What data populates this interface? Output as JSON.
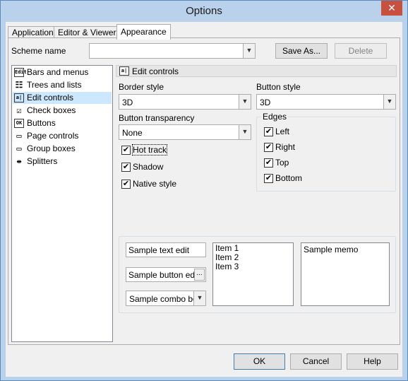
{
  "window": {
    "title": "Options",
    "close_glyph": "✕"
  },
  "tabs": [
    {
      "label": "Application"
    },
    {
      "label": "Editor & Viewers"
    },
    {
      "label": "Appearance",
      "active": true
    }
  ],
  "scheme": {
    "label": "Scheme name",
    "value": "",
    "save_as": "Save As...",
    "delete": "Delete"
  },
  "tree": {
    "items": [
      {
        "label": "Bars and menus",
        "icon": "bars-menus-icon",
        "glyph": "Edit"
      },
      {
        "label": "Trees and lists",
        "icon": "trees-lists-icon",
        "glyph": "☷"
      },
      {
        "label": "Edit controls",
        "icon": "edit-controls-icon",
        "glyph": "a|",
        "selected": true
      },
      {
        "label": "Check boxes",
        "icon": "check-boxes-icon",
        "glyph": "☑"
      },
      {
        "label": "Buttons",
        "icon": "buttons-icon",
        "glyph": "OK"
      },
      {
        "label": "Page controls",
        "icon": "page-controls-icon",
        "glyph": "▭"
      },
      {
        "label": "Group boxes",
        "icon": "group-boxes-icon",
        "glyph": "▭"
      },
      {
        "label": "Splitters",
        "icon": "splitters-icon",
        "glyph": "⇹"
      }
    ]
  },
  "panel": {
    "header": "Edit controls",
    "header_glyph": "a|",
    "border_style": {
      "label": "Border style",
      "value": "3D"
    },
    "button_style": {
      "label": "Button style",
      "value": "3D"
    },
    "button_transparency": {
      "label": "Button transparency",
      "value": "None"
    },
    "hot_track": {
      "label": "Hot track",
      "checked": true
    },
    "shadow": {
      "label": "Shadow",
      "checked": true
    },
    "native_style": {
      "label": "Native style",
      "checked": true
    },
    "edges": {
      "title": "Edges",
      "left": {
        "label": "Left",
        "checked": true
      },
      "right": {
        "label": "Right",
        "checked": true
      },
      "top": {
        "label": "Top",
        "checked": true
      },
      "bottom": {
        "label": "Bottom",
        "checked": true
      }
    },
    "samples": {
      "text_edit": "Sample text edit",
      "button_edit": "Sample button edit",
      "button_edit_glyph": "...",
      "combo_box": "Sample combo box",
      "list_items": [
        "Item 1",
        "Item 2",
        "Item 3"
      ],
      "memo": "Sample memo"
    }
  },
  "footer": {
    "ok": "OK",
    "cancel": "Cancel",
    "help": "Help"
  },
  "checkmark": "✔",
  "drop_glyph": "▼"
}
